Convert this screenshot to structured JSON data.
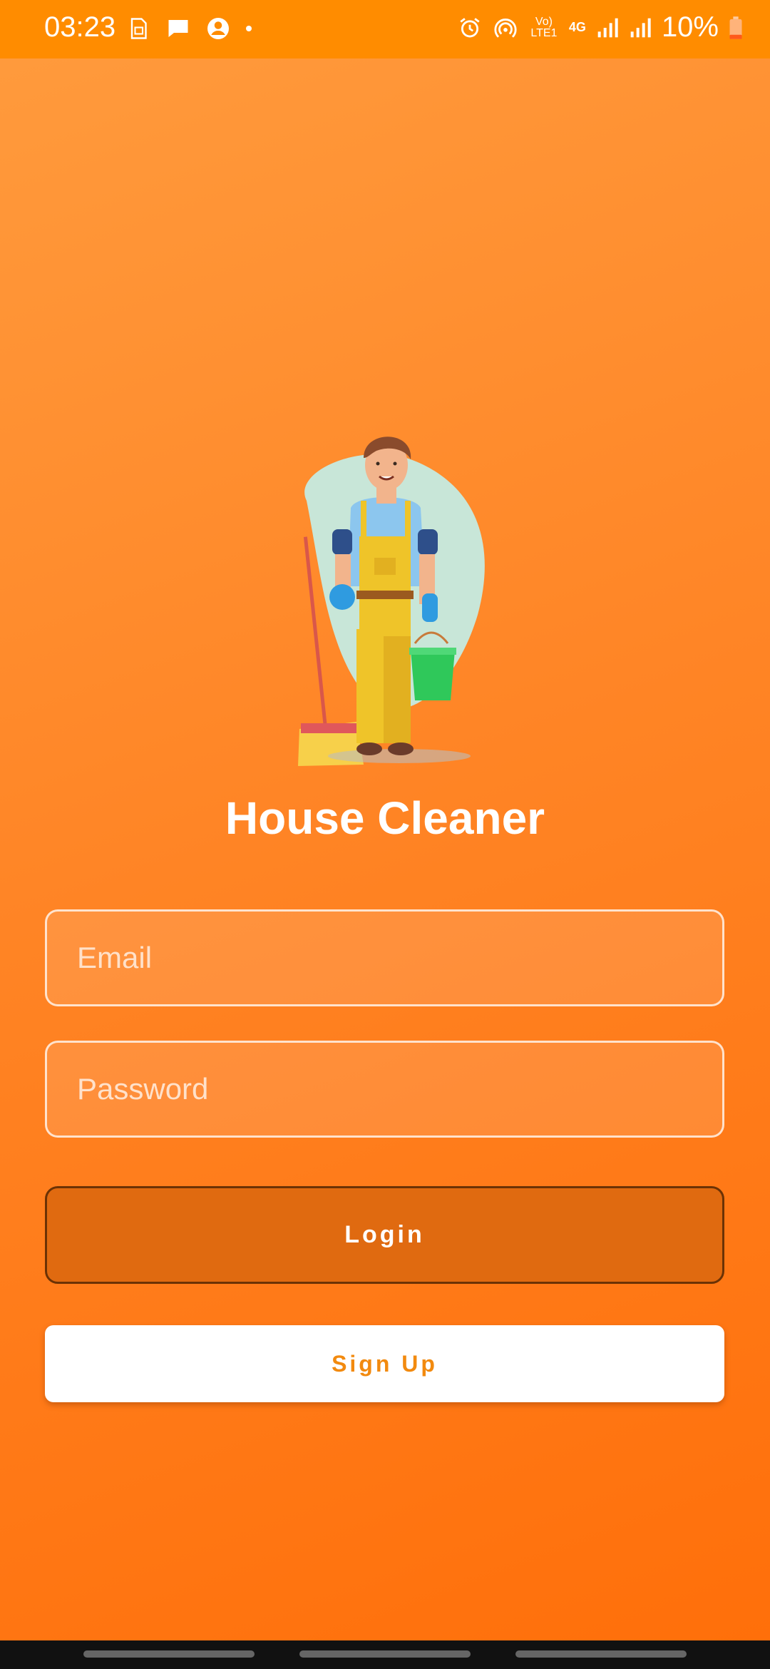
{
  "status_bar": {
    "time": "03:23",
    "left_icons": [
      "sim-card-icon",
      "message-icon",
      "account-icon",
      "dot-icon"
    ],
    "right_icons": [
      "alarm-icon",
      "hotspot-icon",
      "volte-icon",
      "4g-icon",
      "signal-icon",
      "signal-icon"
    ],
    "volte_label": "Vo) LTE1",
    "network_label": "4G",
    "battery": "10%"
  },
  "app": {
    "title": "House Cleaner",
    "illustration": "cleaner-illustration"
  },
  "form": {
    "email_placeholder": "Email",
    "password_placeholder": "Password",
    "login_label": "Login",
    "signup_label": "Sign Up"
  },
  "colors": {
    "status_bar": "#ff8c00",
    "background_top": "#ff9a3c",
    "background_bottom": "#ff6f0a",
    "login_button": "#e06a10",
    "signup_text": "#f28a0f"
  }
}
